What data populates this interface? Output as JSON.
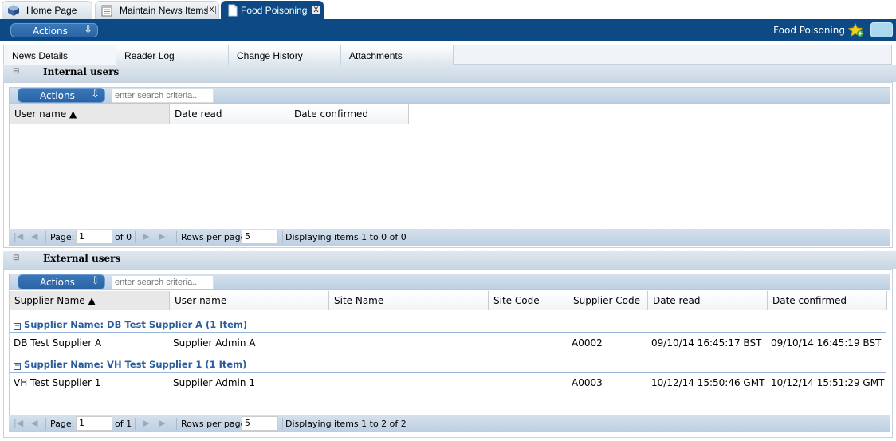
{
  "tabs": [
    {
      "label": "Home Page",
      "icon": "home-cube-icon",
      "closable": false,
      "active": false
    },
    {
      "label": "Maintain News Items",
      "icon": "calendar-list-icon",
      "closable": true,
      "active": false
    },
    {
      "label": "Food Poisoning",
      "icon": "document-icon",
      "closable": true,
      "active": true
    }
  ],
  "tab_close_label": "X",
  "topbar": {
    "actions_label": "Actions",
    "title": "Food Poisoning",
    "favourite_icon": "star-add-icon",
    "screen_icon": "screen-icon"
  },
  "subtabs": [
    "News Details",
    "Reader Log",
    "Change History",
    "Attachments"
  ],
  "internal": {
    "title": "Internal users",
    "collapse_glyph": "⊟",
    "actions_label": "Actions",
    "search_placeholder": "enter search criteria..",
    "columns": [
      "User name ▲",
      "Date read",
      "Date confirmed"
    ],
    "rows": [],
    "pager": {
      "page_label": "Page:",
      "page": "1",
      "of_label": "of 0",
      "rows_label": "Rows per page",
      "rows_per_page": "5",
      "display": "Displaying items 1 to 0 of 0"
    }
  },
  "external": {
    "title": "External users",
    "collapse_glyph": "⊟",
    "actions_label": "Actions",
    "search_placeholder": "enter search criteria..",
    "columns": [
      "Supplier Name ▲",
      "User name",
      "Site Name",
      "Site Code",
      "Supplier Code",
      "Date read",
      "Date confirmed"
    ],
    "groups": [
      {
        "header": "Supplier Name: DB Test Supplier A (1 Item)",
        "rows": [
          {
            "supplier_name": "DB Test Supplier A",
            "user_name": "Supplier Admin A",
            "site_name": "",
            "site_code": "",
            "supplier_code": "A0002",
            "date_read": "09/10/14 16:45:17 BST",
            "date_confirmed": "09/10/14 16:45:19 BST"
          }
        ]
      },
      {
        "header": "Supplier Name: VH Test Supplier 1 (1 Item)",
        "rows": [
          {
            "supplier_name": "VH Test Supplier 1",
            "user_name": "Supplier Admin 1",
            "site_name": "",
            "site_code": "",
            "supplier_code": "A0003",
            "date_read": "10/12/14 15:50:46 GMT",
            "date_confirmed": "10/12/14 15:51:29 GMT"
          }
        ]
      }
    ],
    "pager": {
      "page_label": "Page:",
      "page": "1",
      "of_label": "of 1",
      "rows_label": "Rows per page",
      "rows_per_page": "5",
      "display": "Displaying items 1 to 2 of 2"
    }
  },
  "colors": {
    "brand_blue": "#0d4a85",
    "group_text": "#2a5d9a",
    "group_line": "#97b6da"
  }
}
